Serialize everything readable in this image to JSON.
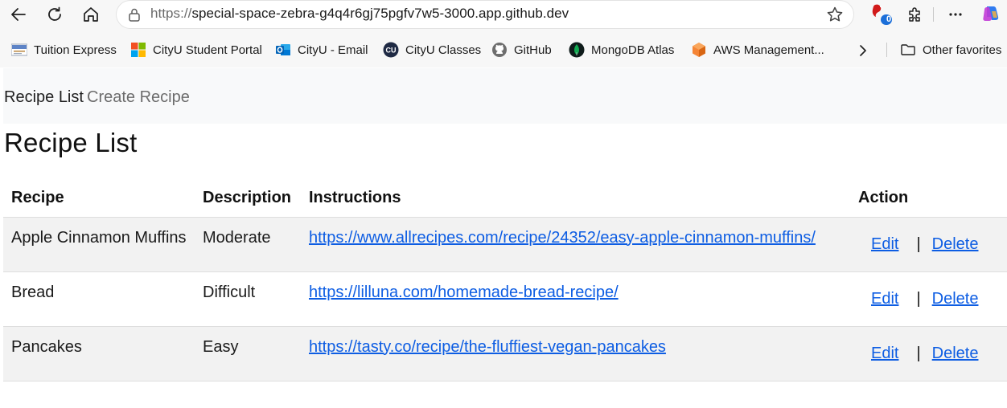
{
  "browser": {
    "url_scheme": "https://",
    "url_rest": "special-space-zebra-g4q4r6gj75pgfv7w5-3000.app.github.dev",
    "extension_badge": "0",
    "favorites": [
      {
        "label": "Tuition Express",
        "icon": "tuition-express-icon"
      },
      {
        "label": "CityU Student Portal",
        "icon": "microsoft-logo-icon"
      },
      {
        "label": "CityU - Email",
        "icon": "outlook-icon"
      },
      {
        "label": "CityU Classes",
        "icon": "cityu-icon"
      },
      {
        "label": "GitHub",
        "icon": "github-icon"
      },
      {
        "label": "MongoDB Atlas",
        "icon": "mongodb-icon"
      },
      {
        "label": "AWS Management...",
        "icon": "aws-icon"
      }
    ],
    "other_favorites": "Other favorites"
  },
  "nav": {
    "brand": "Recipe List",
    "create_link": "Create Recipe"
  },
  "page": {
    "title": "Recipe List"
  },
  "table": {
    "headers": [
      "Recipe",
      "Description",
      "Instructions",
      "Action"
    ],
    "rows": [
      {
        "recipe": "Apple Cinnamon Muffins",
        "description": "Moderate",
        "instructions": "https://www.allrecipes.com/recipe/24352/easy-apple-cinnamon-muffins/",
        "edit": "Edit",
        "sep": "|",
        "delete": "Delete"
      },
      {
        "recipe": "Bread",
        "description": "Difficult",
        "instructions": "https://lilluna.com/homemade-bread-recipe/",
        "edit": "Edit",
        "sep": "|",
        "delete": "Delete"
      },
      {
        "recipe": "Pancakes",
        "description": "Easy",
        "instructions": "https://tasty.co/recipe/the-fluffiest-vegan-pancakes",
        "edit": "Edit",
        "sep": "|",
        "delete": "Delete"
      }
    ]
  },
  "colors": {
    "link": "#0d5de3",
    "navbar_bg": "#f8f9fa",
    "stripe_bg": "#f2f2f2"
  }
}
